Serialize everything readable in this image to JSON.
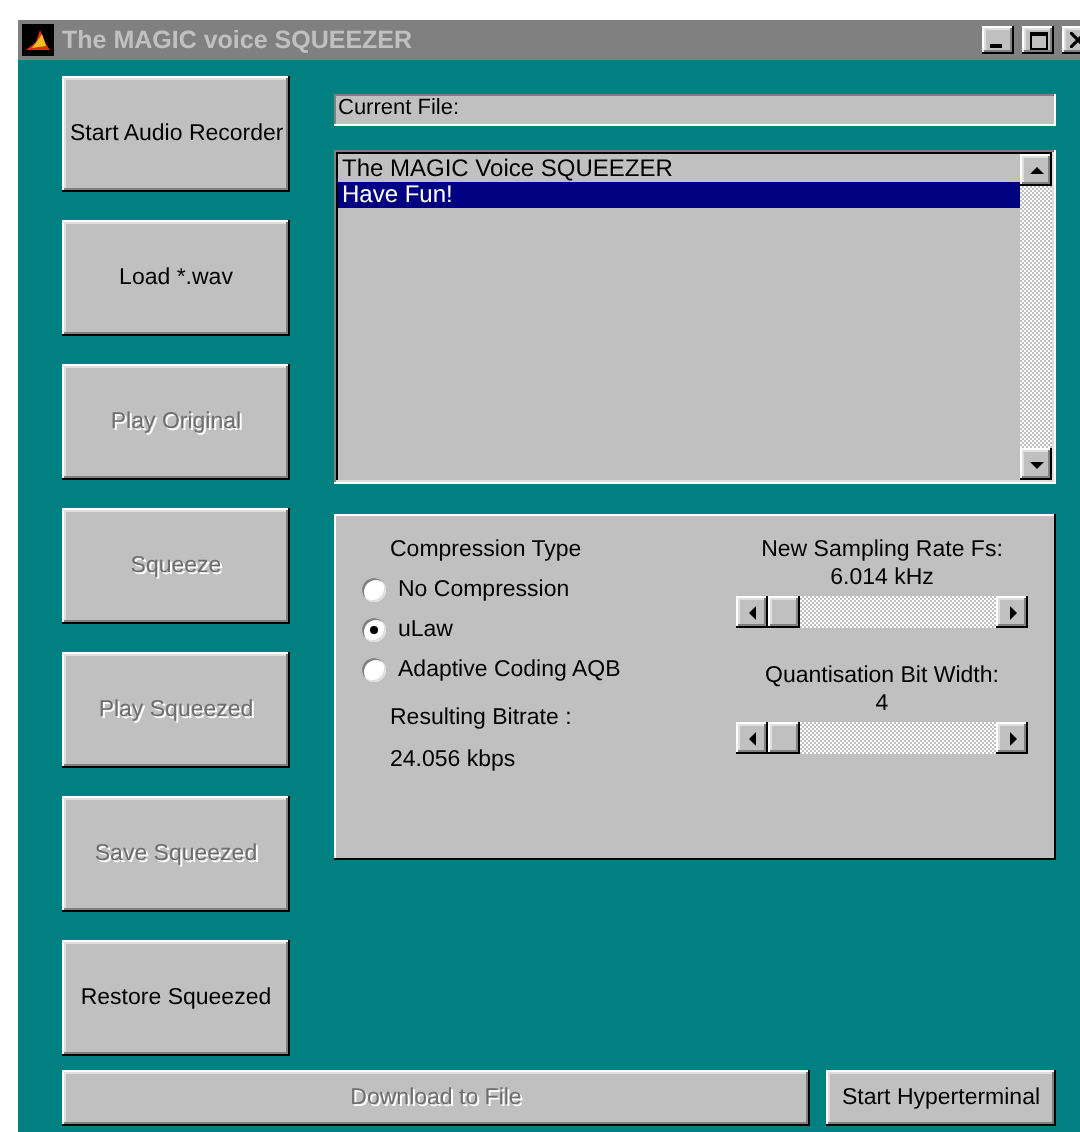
{
  "window": {
    "title": "The MAGIC voice SQUEEZER"
  },
  "buttons": [
    {
      "label": "Start Audio Recorder",
      "disabled": false
    },
    {
      "label": "Load *.wav",
      "disabled": false
    },
    {
      "label": "Play Original",
      "disabled": true
    },
    {
      "label": "Squeeze",
      "disabled": true
    },
    {
      "label": "Play Squeezed",
      "disabled": true
    },
    {
      "label": "Save Squeezed",
      "disabled": true
    },
    {
      "label": "Restore Squeezed",
      "disabled": false
    }
  ],
  "current_file": {
    "label": "Current File:"
  },
  "list": [
    {
      "text": "The MAGIC Voice SQUEEZER",
      "selected": false
    },
    {
      "text": "Have Fun!",
      "selected": true
    }
  ],
  "compression": {
    "title": "Compression Type",
    "options": [
      {
        "label": "No Compression",
        "selected": false
      },
      {
        "label": "uLaw",
        "selected": true
      },
      {
        "label": "Adaptive Coding AQB",
        "selected": false
      }
    ],
    "bitrate_label": "Resulting Bitrate :",
    "bitrate": "24.056 kbps"
  },
  "sliders": [
    {
      "label": "New Sampling Rate Fs:",
      "reading": "6.014 kHz",
      "level": 0
    },
    {
      "label": "Quantisation Bit Width:",
      "reading": "4",
      "level": 0
    }
  ],
  "bottom_buttons": [
    {
      "label": "Download to File",
      "disabled": true
    },
    {
      "label": "Start Hyperterminal",
      "disabled": false
    }
  ]
}
